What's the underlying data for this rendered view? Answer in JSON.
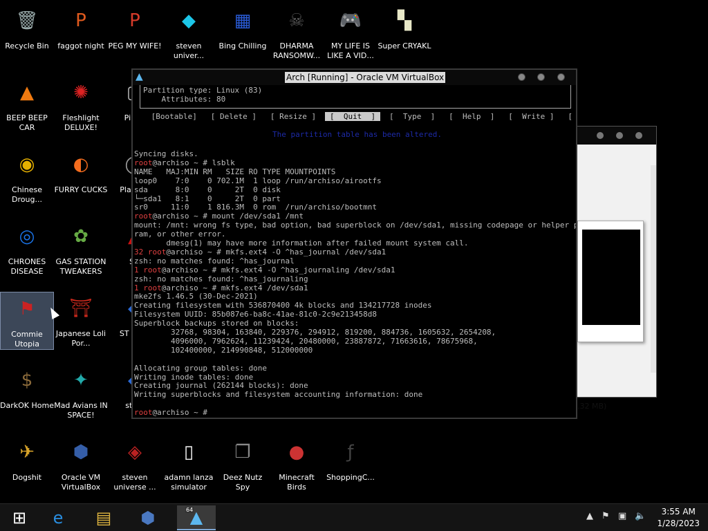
{
  "desktop": {
    "icons": [
      {
        "label": "Recycle Bin",
        "glyph": "🗑",
        "icon": "recycle-bin-icon"
      },
      {
        "label": "faggot night",
        "glyph": "P",
        "icon": "p-logo-icon"
      },
      {
        "label": "PEG MY WIFE!",
        "glyph": "P",
        "icon": "p-logo-icon"
      },
      {
        "label": "steven univer...",
        "glyph": "◆",
        "icon": "diamond-icon"
      },
      {
        "label": "Bing Chilling",
        "glyph": "▦",
        "icon": "box-art-icon"
      },
      {
        "label": "DHARMA RANSOMW...",
        "glyph": "☠",
        "icon": "skull-icon"
      },
      {
        "label": "MY LIFE IS LIKE A VID...",
        "glyph": "🎮",
        "icon": "gamepad-icon"
      },
      {
        "label": "Super CRYAKL",
        "glyph": "▚",
        "icon": "pixel-dog-icon"
      },
      {
        "label": "BEEP BEEP CAR",
        "glyph": "▲",
        "icon": "traffic-cone-icon"
      },
      {
        "label": "Fleshlight DELUXE!",
        "glyph": "✺",
        "icon": "red-creature-icon"
      },
      {
        "label": "Pi Chi",
        "glyph": "▢",
        "icon": "app-icon"
      },
      {
        "label": "Chinese Droug...",
        "glyph": "◉",
        "icon": "chinese-coin-icon"
      },
      {
        "label": "FURRY CUCKS",
        "glyph": "◐",
        "icon": "firefox-icon"
      },
      {
        "label": "Play Shi",
        "glyph": "◯",
        "icon": "app-icon"
      },
      {
        "label": "CHRONES DISEASE",
        "glyph": "◎",
        "icon": "chrome-icon"
      },
      {
        "label": "GAS STATION TWEAKERS",
        "glyph": "✿",
        "icon": "flower-icon"
      },
      {
        "label": "SO",
        "glyph": "▲",
        "icon": "app-icon"
      },
      {
        "label": "Commie Utopia",
        "glyph": "⚑",
        "icon": "commie-flag-icon"
      },
      {
        "label": "Japanese Loli Por...",
        "glyph": "⛩",
        "icon": "torii-icon"
      },
      {
        "label": "ST UNIV",
        "glyph": "◆",
        "icon": "app-icon"
      },
      {
        "label": "DarkOK Home",
        "glyph": "$",
        "icon": "money-bag-icon"
      },
      {
        "label": "Mad Avians IN SPACE!",
        "glyph": "✦",
        "icon": "angry-birds-space-icon"
      },
      {
        "label": "st un",
        "glyph": "◆",
        "icon": "app-icon"
      },
      {
        "label": "Dogshit",
        "glyph": "✈",
        "icon": "gold-plane-icon"
      },
      {
        "label": "Oracle VM VirtualBox",
        "glyph": "⬢",
        "icon": "virtualbox-icon"
      },
      {
        "label": "steven universe ...",
        "glyph": "◈",
        "icon": "gem-icon"
      },
      {
        "label": "adamn lanza simulator",
        "glyph": "▯",
        "icon": "blank-file-icon"
      },
      {
        "label": "Deez Nutz Spy",
        "glyph": "❐",
        "icon": "stacked-windows-icon"
      },
      {
        "label": "Minecraft Birds",
        "glyph": "●",
        "icon": "angry-bird-icon"
      },
      {
        "label": "ShoppingC...",
        "glyph": "ƒ",
        "icon": "flash-icon"
      }
    ]
  },
  "vbox": {
    "title": "Arch [Running] - Oracle VM VirtualBox"
  },
  "back_window": {
    "size_text": ".32 MB)"
  },
  "terminal": {
    "partition_type": "Partition type: Linux (83)",
    "attributes": "    Attributes: 80",
    "menu": [
      " [Bootable] ",
      " [ Delete ] ",
      " [ Resize ] ",
      " [  Quit  ] ",
      " [  Type  ] ",
      " [  Help  ] ",
      " [  Write ] ",
      " [  Dump  ] "
    ],
    "menu_selected": 3,
    "blue_hint": "The partition table has been altered.",
    "lines": [
      {
        "text": "Syncing disks.",
        "cls": ""
      },
      {
        "prompt_red": "",
        "text": "root@archiso ~ # lsblk",
        "cls": "",
        "red_root": true
      },
      {
        "text": "NAME   MAJ:MIN RM   SIZE RO TYPE MOUNTPOINTS",
        "cls": ""
      },
      {
        "text": "loop0    7:0    0 702.1M  1 loop /run/archiso/airootfs",
        "cls": ""
      },
      {
        "text": "sda      8:0    0     2T  0 disk",
        "cls": ""
      },
      {
        "text": "└─sda1   8:1    0     2T  0 part",
        "cls": ""
      },
      {
        "text": "sr0     11:0    1 816.3M  0 rom  /run/archiso/bootmnt",
        "cls": ""
      },
      {
        "text": "root@archiso ~ # mount /dev/sda1 /mnt",
        "cls": "",
        "red_root": true
      },
      {
        "text": "mount: /mnt: wrong fs type, bad option, bad superblock on /dev/sda1, missing codepage or helper prog",
        "cls": ""
      },
      {
        "text": "ram, or other error.",
        "cls": ""
      },
      {
        "text": "       dmesg(1) may have more information after failed mount system call.",
        "cls": ""
      },
      {
        "text": "32 root@archiso ~ # mkfs.ext4 -O ^has_journal /dev/sda1",
        "cls": "",
        "red_prefix": "32 root"
      },
      {
        "text": "zsh: no matches found: ^has_journal",
        "cls": ""
      },
      {
        "text": "1 root@archiso ~ # mkfs.ext4 -O ^has_journaling /dev/sda1",
        "cls": "",
        "red_prefix": "1 root"
      },
      {
        "text": "zsh: no matches found: ^has_journaling",
        "cls": ""
      },
      {
        "text": "1 root@archiso ~ # mkfs.ext4 /dev/sda1",
        "cls": "",
        "red_prefix": "1 root"
      },
      {
        "text": "mke2fs 1.46.5 (30-Dec-2021)",
        "cls": ""
      },
      {
        "text": "Creating filesystem with 536870400 4k blocks and 134217728 inodes",
        "cls": ""
      },
      {
        "text": "Filesystem UUID: 85b087e6-ba8c-41ae-81c0-2c9e213458d8",
        "cls": ""
      },
      {
        "text": "Superblock backups stored on blocks:",
        "cls": ""
      },
      {
        "text": "        32768, 98304, 163840, 229376, 294912, 819200, 884736, 1605632, 2654208,",
        "cls": ""
      },
      {
        "text": "        4096000, 7962624, 11239424, 20480000, 23887872, 71663616, 78675968,",
        "cls": ""
      },
      {
        "text": "        102400000, 214990848, 512000000",
        "cls": ""
      },
      {
        "text": "",
        "cls": ""
      },
      {
        "text": "Allocating group tables: done",
        "cls": ""
      },
      {
        "text": "Writing inode tables: done",
        "cls": ""
      },
      {
        "text": "Creating journal (262144 blocks): done",
        "cls": ""
      },
      {
        "text": "Writing superblocks and filesystem accounting information: done",
        "cls": ""
      },
      {
        "text": "",
        "cls": ""
      },
      {
        "text": "root@archiso ~ #",
        "cls": "",
        "red_root": true
      }
    ]
  },
  "taskbar": {
    "items": [
      {
        "name": "start-button",
        "glyph": "⊞"
      },
      {
        "name": "internet-explorer-button",
        "glyph": "e"
      },
      {
        "name": "file-explorer-button",
        "glyph": "▤"
      },
      {
        "name": "virtualbox-taskbar-button",
        "glyph": "⬢"
      },
      {
        "name": "arch-vm-taskbar-button",
        "glyph": "▲",
        "badge": "64"
      }
    ],
    "tray": {
      "expand": "▲",
      "flag": "⚑",
      "network": "▣",
      "volume": "🔈"
    },
    "time": "3:55 AM",
    "date": "1/28/2023"
  },
  "colors": {
    "prompt_red": "#e04040",
    "accent": "#7fa9d6"
  }
}
